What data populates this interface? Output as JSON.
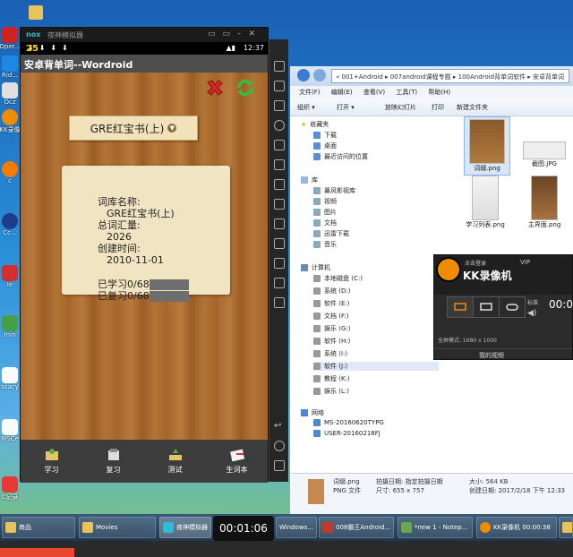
{
  "desktop": {
    "icons": [
      {
        "label": "Oper..."
      },
      {
        "label": "Rid..."
      },
      {
        "label": "Ocz"
      },
      {
        "label": "KK录像"
      },
      {
        "label": "c"
      },
      {
        "label": "Cc..."
      },
      {
        "label": "le"
      },
      {
        "label": "Inin"
      },
      {
        "label": "ssacy"
      },
      {
        "label": "MSCe"
      },
      {
        "label": "C记录"
      }
    ]
  },
  "nox": {
    "brand": "nox",
    "window_title": "夜神模拟器",
    "status_time": "12:37",
    "app_title": "安卓背单词--Wordroid",
    "book_select": "GRE红宝书(上)",
    "info": {
      "name_label": "词库名称:",
      "name_value": "GRE红宝书(上)",
      "total_label": "总词汇量:",
      "total_value": "2026",
      "created_label": "创建时间:",
      "created_value": "2010-11-01",
      "learned": "已学习0/68",
      "reviewed": "已复习0/68"
    },
    "nav": [
      {
        "label": "学习"
      },
      {
        "label": "复习"
      },
      {
        "label": "测试"
      },
      {
        "label": "生词本"
      }
    ]
  },
  "explorer": {
    "path": "« 001+Android ▸ 007android课程专题 ▸ 100Android背单词软件 ▸ 安卓背单词",
    "menu": [
      "文件(F)",
      "编辑(E)",
      "查看(V)",
      "工具(T)",
      "帮助(H)"
    ],
    "toolbar": {
      "organize": "组织 ▾",
      "open": "打开 ▾",
      "slideshow": "放映幻灯片",
      "print": "打印",
      "new_folder": "新建文件夹"
    },
    "favorites_title": "收藏夹",
    "favorites": [
      "下载",
      "桌面",
      "最近访问的位置"
    ],
    "library_title": "库",
    "libraries": [
      "暴风影视库",
      "视频",
      "图片",
      "文档",
      "迅雷下载",
      "音乐"
    ],
    "computer_title": "计算机",
    "drives": [
      "本地磁盘 (C:)",
      "系统 (D:)",
      "软件 (E:)",
      "文档 (F:)",
      "娱乐 (G:)",
      "软件 (H:)",
      "系统 (I:)",
      "软件 (J:)",
      "教程 (K:)",
      "娱乐 (L:)"
    ],
    "network_title": "网络",
    "network": [
      "MS-20160620TYPG",
      "USER-20160218FJ"
    ],
    "files": [
      {
        "name": "词缀.png"
      },
      {
        "name": "截图.JPG"
      },
      {
        "name": "学习列表.png"
      },
      {
        "name": "主界面.png"
      }
    ],
    "details": {
      "filename": "词缀.png",
      "filetype": "PNG 文件",
      "taken": "拍摄日期: 指定拍摄日期",
      "dims": "尺寸: 655 x 757",
      "size": "大小: 564 KB",
      "created": "创建日期: 2017/2/18 下午 12:33"
    }
  },
  "kk": {
    "login": "点击登录",
    "vip": "VIP",
    "name": "KK录像机",
    "timer": "00:0",
    "vol_label": "标准",
    "res": "全屏模式: 1680 x 1000",
    "footer": "我的视频"
  },
  "taskbar": {
    "items": [
      {
        "label": "商品"
      },
      {
        "label": "Movies"
      },
      {
        "label": "夜神模拟器"
      },
      {
        "label": "Windows..."
      },
      {
        "label": "008霸王Android..."
      },
      {
        "label": "*new 1 - Notep..."
      },
      {
        "label": "KK录像机 00:00:38"
      }
    ]
  },
  "video": {
    "time": "00:01:06",
    "progress_fraction": 0.13
  }
}
